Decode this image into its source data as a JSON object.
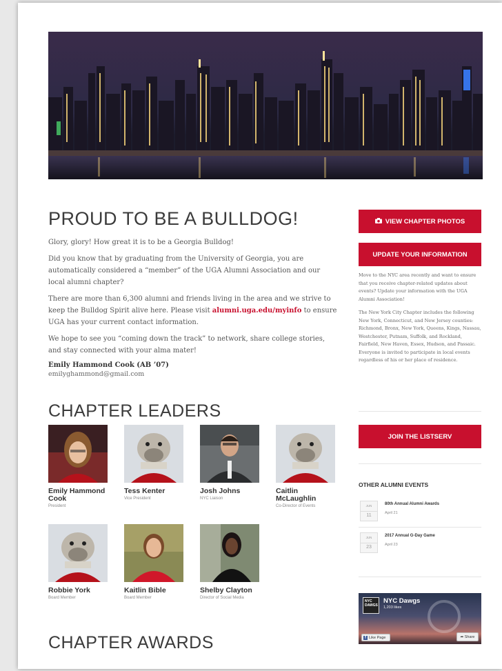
{
  "hero": {
    "alt": "New York City skyline at night"
  },
  "main": {
    "heading": "PROUD TO BE A BULLDOG!",
    "intro": "Glory, glory! How great it is to be a Georgia Bulldog!",
    "p1": "Did you know that by graduating from the University of Georgia, you are automatically considered a “member” of the UGA Alumni Association and our local alumni chapter?",
    "p2_before": "There are more than 6,300 alumni and friends living in the area and we strive to keep the Bulldog Spirit alive here. Please visit ",
    "p2_link": "alumni.uga.edu/myinfo",
    "p2_after": " to ensure UGA has your current contact information.",
    "p3": "We hope to see you “coming down the track” to network, share college stories, and stay connected with your alma mater!",
    "signature_name": "Emily Hammond Cook (AB ’07)",
    "signature_email": "emilyghammond@gmail.com"
  },
  "leaders": {
    "heading": "CHAPTER LEADERS",
    "items": [
      {
        "name": "Emily Hammond Cook",
        "role": "President"
      },
      {
        "name": "Tess Kenter",
        "role": "Vice President"
      },
      {
        "name": "Josh Johns",
        "role": "NYC Liaison"
      },
      {
        "name": "Caitlin McLaughlin",
        "role": "Co-Director of Events"
      },
      {
        "name": "Robbie York",
        "role": "Board Member"
      },
      {
        "name": "Kaitlin Bible",
        "role": "Board Member"
      },
      {
        "name": "Shelby Clayton",
        "role": "Director of Social Media"
      }
    ]
  },
  "awards": {
    "heading": "CHAPTER AWARDS"
  },
  "sidebar": {
    "photos_btn": "VIEW CHAPTER PHOTOS",
    "update_btn": "UPDATE YOUR INFORMATION",
    "text1": "Move to the NYC area recently and want to ensure that you receive chapter-related updates about events? Update your information with the UGA Alumni Association!",
    "text2": "The New York City Chapter includes the following New York, Connecticut, and New Jersey counties: Richmond, Bronx, New York, Queens, Kings, Nassau, Westchester, Putnam, Suffolk, and Rockland, Fairfield, New Haven, Essex, Hudson, and Passaic. Everyone is invited to participate in local events regardless of his or her place of residence.",
    "listserv_btn": "JOIN THE LISTSERV",
    "events_heading": "OTHER ALUMNI EVENTS",
    "events": [
      {
        "month": "JUN",
        "day": "11",
        "title": "80th Annual Alumni Awards",
        "date": "April 21"
      },
      {
        "month": "JUN",
        "day": "23",
        "title": "2017 Annual G-Day Game",
        "date": "April 23"
      }
    ],
    "fb": {
      "name": "NYC Dawgs",
      "likes": "1,203 likes",
      "like": "Like Page",
      "share": "Share",
      "logo": "NYC DAWGS"
    }
  },
  "colors": {
    "accent": "#c8102e"
  }
}
